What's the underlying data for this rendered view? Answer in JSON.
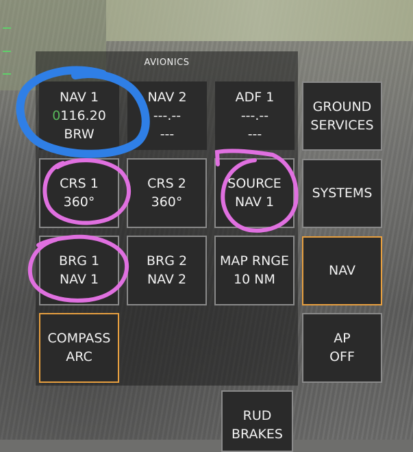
{
  "panel": {
    "title": "AVIONICS"
  },
  "buttons": {
    "nav1": {
      "label": "NAV 1",
      "cursor_digit": "0",
      "freq": "116.20",
      "ident": "BRW"
    },
    "nav2": {
      "label": "NAV 2",
      "freq": "---.--",
      "ident": "---"
    },
    "adf1": {
      "label": "ADF 1",
      "freq": "---.--",
      "ident": "---"
    },
    "ground_services": {
      "line1": "GROUND",
      "line2": "SERVICES"
    },
    "crs1": {
      "label": "CRS 1",
      "value": "360°"
    },
    "crs2": {
      "label": "CRS 2",
      "value": "360°"
    },
    "source": {
      "label": "SOURCE",
      "value": "NAV 1"
    },
    "systems": {
      "label": "SYSTEMS"
    },
    "brg1": {
      "label": "BRG 1",
      "value": "NAV 1"
    },
    "brg2": {
      "label": "BRG 2",
      "value": "NAV 2"
    },
    "map_range": {
      "label": "MAP RNGE",
      "value": "10 NM"
    },
    "nav": {
      "label": "NAV"
    },
    "compass": {
      "label": "COMPASS",
      "value": "ARC"
    },
    "ap": {
      "label": "AP",
      "value": "OFF"
    },
    "rud_brakes": {
      "label": "RUD",
      "value": "BRAKES"
    }
  },
  "colors": {
    "button_bg": "#2a2a2a",
    "button_border": "#8a8a8a",
    "active_border": "#e8a040",
    "annotation_blue": "#2f7fe6",
    "annotation_pink": "#e070e0",
    "cursor_green": "#57b85a"
  }
}
